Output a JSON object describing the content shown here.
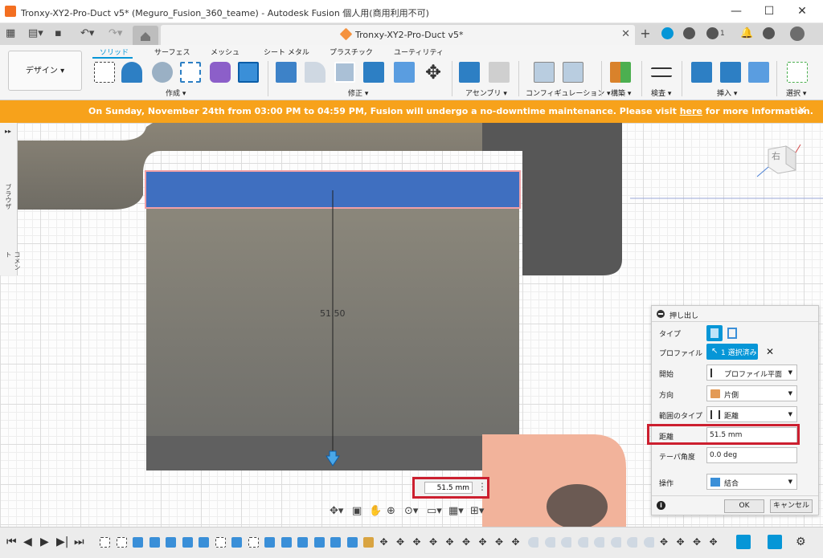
{
  "window": {
    "title": "Tronxy-XY2-Pro-Duct v5* (Meguro_Fusion_360_teame) - Autodesk Fusion 個人用(商用利用不可)",
    "minimize": "—",
    "maximize": "☐",
    "close": "✕"
  },
  "tabs": {
    "doc_label": "Tronxy-XY2-Pro-Duct v5*",
    "close": "✕",
    "plus": "+",
    "jobs_count": "1"
  },
  "toolbar": {
    "workspace": "デザイン ▾",
    "tabs": [
      "ソリッド",
      "サーフェス",
      "メッシュ",
      "シート メタル",
      "プラスチック",
      "ユーティリティ"
    ],
    "groups": [
      "作成 ▾",
      "修正 ▾",
      "アセンブリ ▾",
      "コンフィギュレーション ▾",
      "構築 ▾",
      "検査 ▾",
      "挿入 ▾",
      "選択 ▾"
    ]
  },
  "banner": {
    "pre": "On Sunday, November 24th from 03:00 PM to 04:59 PM, Fusion will undergo a no-downtime maintenance. Please visit ",
    "link": "here",
    "post": " for more information.",
    "close": "✕"
  },
  "sidebar": {
    "browser": "ブラウザ",
    "comments": "コメント"
  },
  "viewport": {
    "dimension": "51.50",
    "inline_value": "51.5 mm",
    "viewcube_face": "右"
  },
  "panel": {
    "title": "押し出し",
    "type_label": "タイプ",
    "profile_label": "プロファイル",
    "profile_value": "1 選択済み",
    "start_label": "開始",
    "start_value": "プロファイル平面",
    "direction_label": "方向",
    "direction_value": "片側",
    "extent_label": "範囲のタイプ",
    "extent_value": "距離",
    "distance_label": "距離",
    "distance_value": "51.5 mm",
    "taper_label": "テーパ角度",
    "taper_value": "0.0 deg",
    "operation_label": "操作",
    "operation_value": "結合",
    "ok": "OK",
    "cancel": "キャンセル"
  },
  "colors": {
    "accent": "#0696d7",
    "banner": "#f7a21b",
    "highlight": "#cc1f2f",
    "extrude_face": "#3f6fc0",
    "body": "#7a7a72",
    "part": "#f2b39b"
  }
}
